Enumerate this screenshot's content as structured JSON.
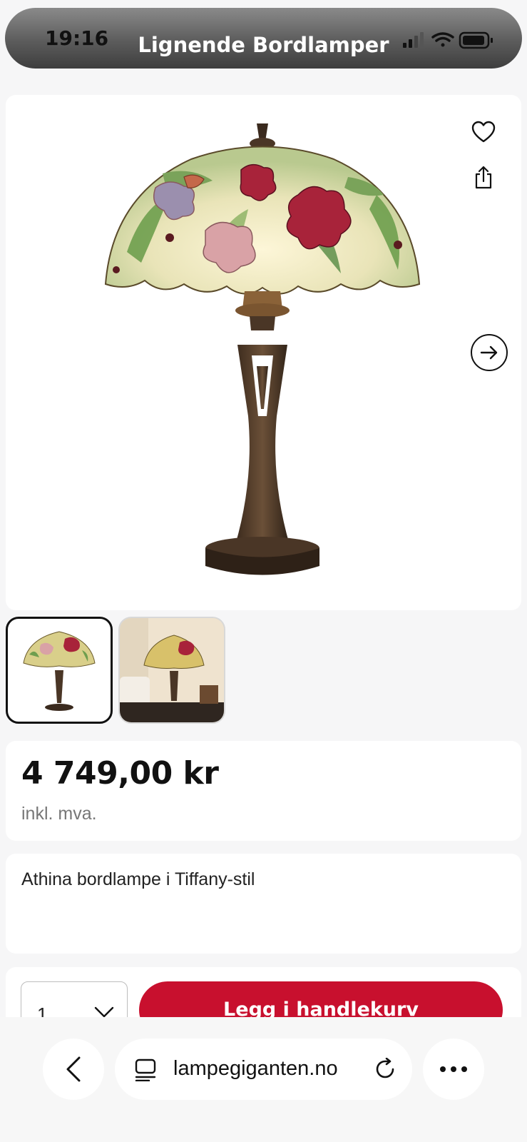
{
  "status_bar": {
    "time": "19:16",
    "title": "Lignende Bordlamper"
  },
  "gallery": {
    "favorite_icon": "heart-icon",
    "share_icon": "share-icon",
    "next_icon": "arrow-right-circle-icon",
    "thumbnail_count": 2
  },
  "product": {
    "price": "4 749,00 kr",
    "vat_note": "inkl. mva.",
    "title": "Athina bordlampe i Tiffany-stil"
  },
  "cart": {
    "quantity": "1",
    "add_label": "Legg i handlekurv",
    "button_color": "#c8102e"
  },
  "browser": {
    "url": "lampegiganten.no",
    "back_icon": "chevron-left-icon",
    "tabs_icon": "tab-icon",
    "reload_icon": "reload-icon",
    "more_icon": "more-dots-icon"
  }
}
